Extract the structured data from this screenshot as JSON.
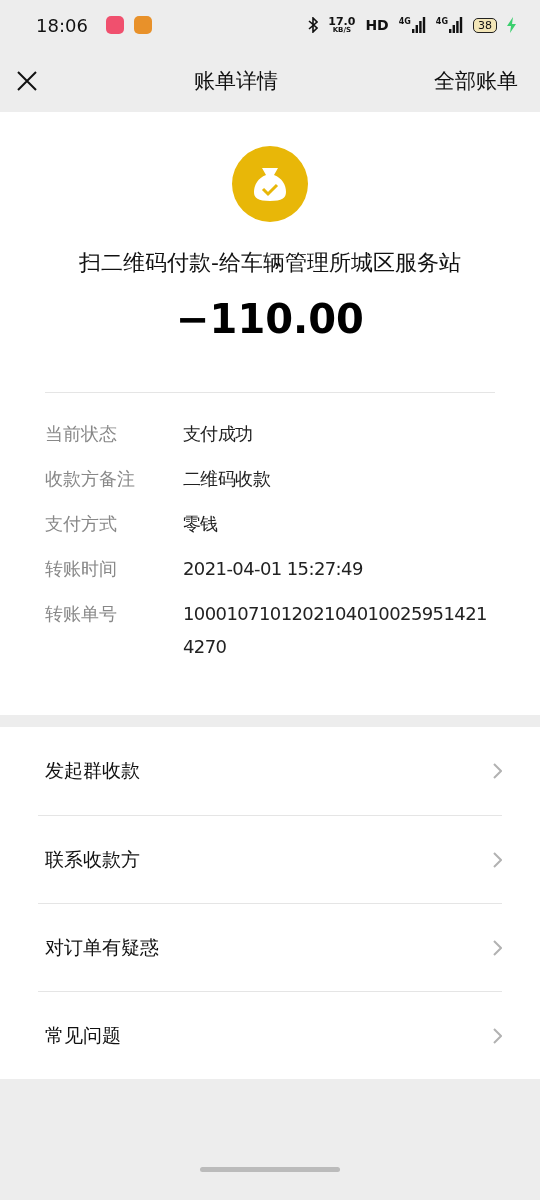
{
  "status_bar": {
    "time": "18:06",
    "speed": "17.0",
    "speed_unit": "KB/S",
    "hd": "HD",
    "networks": [
      "4G",
      "4G"
    ],
    "battery": "38",
    "charging": true
  },
  "nav": {
    "title": "账单详情",
    "action": "全部账单"
  },
  "bill": {
    "merchant": "扫二维码付款-给车辆管理所城区服务站",
    "amount": "−110.00"
  },
  "details": [
    {
      "label": "当前状态",
      "value": "支付成功"
    },
    {
      "label": "收款方备注",
      "value": "二维码收款"
    },
    {
      "label": "支付方式",
      "value": "零钱"
    },
    {
      "label": "转账时间",
      "value": "2021-04-01 15:27:49"
    },
    {
      "label": "转账单号",
      "value": "10001071012021040100259514214270"
    }
  ],
  "menu": [
    "发起群收款",
    "联系收款方",
    "对订单有疑惑",
    "常见问题"
  ]
}
